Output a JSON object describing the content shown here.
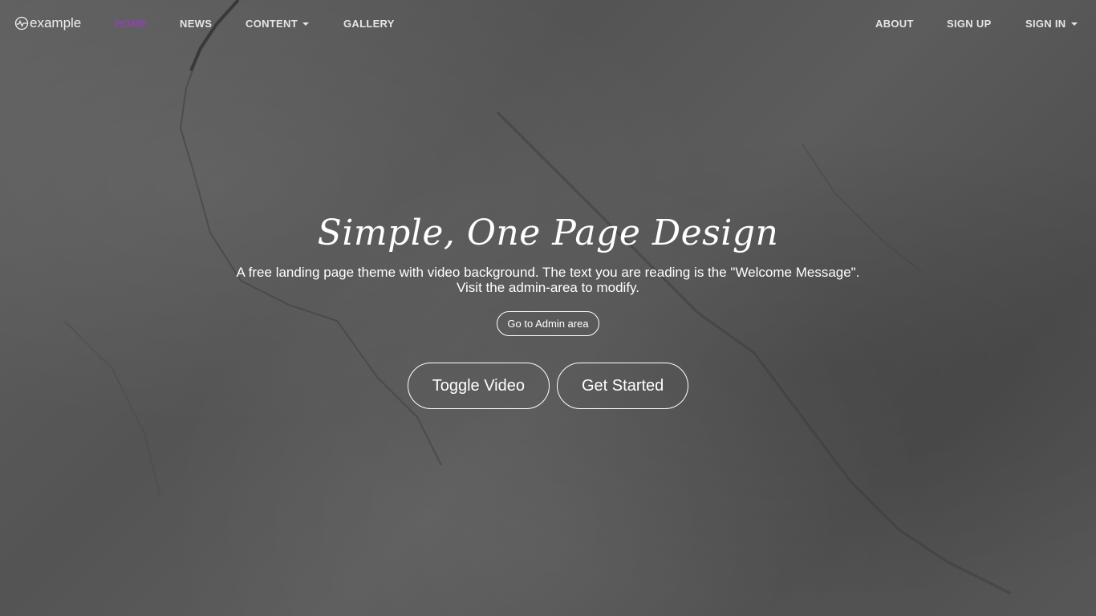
{
  "brand": {
    "name": "example",
    "icon": "pulse-logo-icon"
  },
  "nav": {
    "left": [
      {
        "label": "HOME",
        "active": true
      },
      {
        "label": "NEWS",
        "active": false
      },
      {
        "label": "CONTENT",
        "active": false,
        "dropdown": true
      },
      {
        "label": "GALLERY",
        "active": false
      }
    ],
    "right": [
      {
        "label": "ABOUT"
      },
      {
        "label": "SIGN UP"
      },
      {
        "label": "SIGN IN",
        "dropdown": true
      }
    ]
  },
  "hero": {
    "title": "Simple, One Page Design",
    "message_line1": "A free landing page theme with video background.  The text you are reading is the \"Welcome Message\".",
    "message_line2": "Visit the admin-area to modify.",
    "admin_button": "Go to Admin area",
    "toggle_video_button": "Toggle Video",
    "get_started_button": "Get Started"
  },
  "colors": {
    "active_nav": "#8e44ad",
    "nav_text": "#e6e6e6",
    "hero_text": "#ffffff",
    "background": "#5a5a5a"
  }
}
